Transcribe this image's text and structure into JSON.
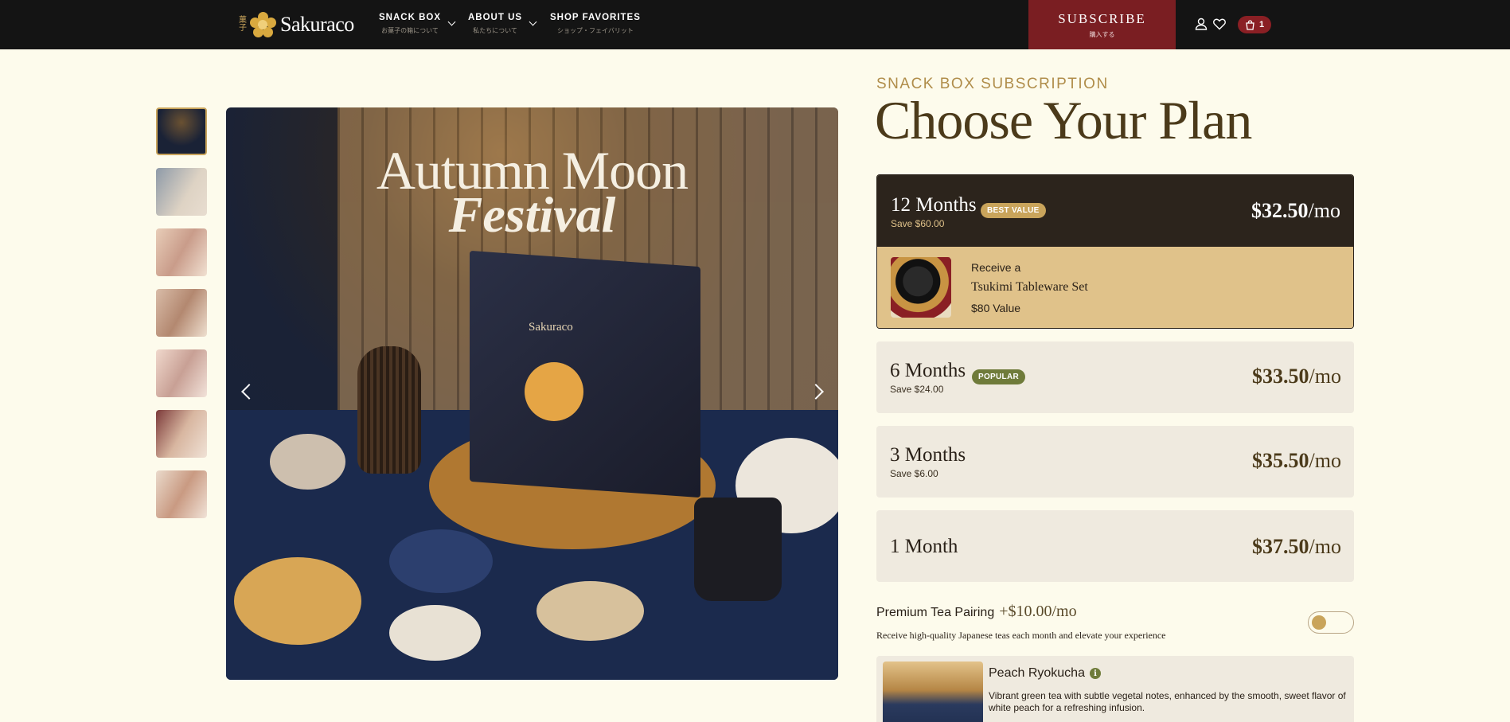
{
  "header": {
    "logo_kanji": "菓子",
    "logo_text": "Sakuraco",
    "nav": [
      {
        "label": "SNACK BOX",
        "sub": "お菓子の箱について"
      },
      {
        "label": "ABOUT US",
        "sub": "私たちについて"
      },
      {
        "label": "SHOP FAVORITES",
        "sub": "ショップ・フェイバリット"
      }
    ],
    "subscribe_label": "SUBSCRIBE",
    "subscribe_sub": "購入する",
    "cart_count": "1",
    "icons": [
      "user-icon",
      "heart-icon",
      "cart-icon"
    ]
  },
  "gallery": {
    "thumb_count": 7,
    "active_index": 0,
    "main_title_line1": "Autumn Moon",
    "main_title_line2": "Festival",
    "box_logo": "Sakuraco",
    "prev_icon": "chevron-left-icon",
    "next_icon": "chevron-right-icon"
  },
  "plan": {
    "eyebrow": "SNACK BOX SUBSCRIPTION",
    "headline": "Choose Your Plan",
    "options": [
      {
        "name": "12 Months",
        "badge": "BEST VALUE",
        "save": "Save $60.00",
        "price": "$32.50",
        "unit": "/mo",
        "selected": true
      },
      {
        "name": "6 Months",
        "badge": "POPULAR",
        "save": "Save $24.00",
        "price": "$33.50",
        "unit": "/mo"
      },
      {
        "name": "3 Months",
        "save": "Save $6.00",
        "price": "$35.50",
        "unit": "/mo"
      },
      {
        "name": "1 Month",
        "price": "$37.50",
        "unit": "/mo"
      }
    ],
    "gift": {
      "pre": "Receive a",
      "name": "Tsukimi Tableware Set",
      "value": "$80 Value"
    }
  },
  "tea": {
    "label": "Premium Tea Pairing",
    "price": "+$10.00/mo",
    "description": "Receive high-quality Japanese teas each month and elevate your experience",
    "toggle_on": false,
    "card_name": "Peach Ryokucha",
    "card_info_icon": "i",
    "card_text": "Vibrant green tea with subtle vegetal notes, enhanced by the smooth, sweet flavor of white peach for a refreshing infusion."
  },
  "colors": {
    "page_bg": "#fdfbec",
    "header_bg": "#141414",
    "subscribe_bg": "#7a1e22",
    "gold": "#c9a45b",
    "selected_plan_bg": "#2c241c",
    "gift_bg": "#e0c28a",
    "best_value_badge": "#c9a45b",
    "popular_badge": "#6f7b3a"
  }
}
